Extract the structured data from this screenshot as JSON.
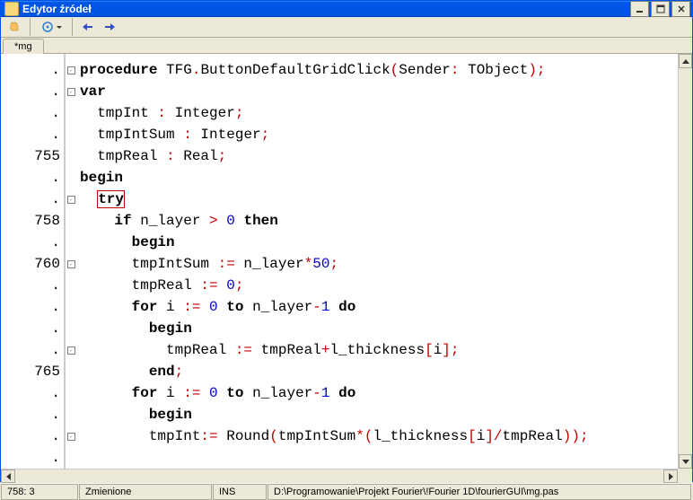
{
  "window": {
    "title": "Edytor źródeł"
  },
  "tab": {
    "label": "*mg"
  },
  "gutter": [
    ".",
    ".",
    ".",
    ".",
    "755",
    ".",
    ".",
    "758",
    ".",
    "760",
    ".",
    ".",
    ".",
    ".",
    "765",
    ".",
    ".",
    ".",
    "."
  ],
  "fold": [
    "-",
    "-",
    "",
    "",
    "",
    "",
    "-",
    "",
    "",
    "-",
    "",
    "",
    "",
    "-",
    "",
    "",
    "",
    "-",
    ""
  ],
  "code": [
    [
      [
        "kw",
        "procedure"
      ],
      [
        "txt",
        " TFG"
      ],
      [
        "sym",
        "."
      ],
      [
        "txt",
        "ButtonDefaultGridClick"
      ],
      [
        "sym",
        "("
      ],
      [
        "txt",
        "Sender"
      ],
      [
        "sym",
        ":"
      ],
      [
        "txt",
        " TObject"
      ],
      [
        "sym",
        ");"
      ]
    ],
    [
      [
        "kw",
        "var"
      ]
    ],
    [
      [
        "txt",
        "  tmpInt "
      ],
      [
        "sym",
        ":"
      ],
      [
        "txt",
        " Integer"
      ],
      [
        "sym",
        ";"
      ]
    ],
    [
      [
        "txt",
        "  tmpIntSum "
      ],
      [
        "sym",
        ":"
      ],
      [
        "txt",
        " Integer"
      ],
      [
        "sym",
        ";"
      ]
    ],
    [
      [
        "txt",
        "  tmpReal "
      ],
      [
        "sym",
        ":"
      ],
      [
        "txt",
        " Real"
      ],
      [
        "sym",
        ";"
      ]
    ],
    [
      [
        "kw",
        "begin"
      ]
    ],
    [
      [
        "txt",
        "  "
      ],
      [
        "tryhl",
        "try"
      ]
    ],
    [
      [
        "txt",
        "    "
      ],
      [
        "kw",
        "if"
      ],
      [
        "txt",
        " n_layer "
      ],
      [
        "sym",
        ">"
      ],
      [
        "txt",
        " "
      ],
      [
        "num",
        "0"
      ],
      [
        "txt",
        " "
      ],
      [
        "kw",
        "then"
      ]
    ],
    [
      [
        "txt",
        "      "
      ],
      [
        "kw",
        "begin"
      ]
    ],
    [
      [
        "txt",
        "      tmpIntSum "
      ],
      [
        "sym",
        ":="
      ],
      [
        "txt",
        " n_layer"
      ],
      [
        "sym",
        "*"
      ],
      [
        "num",
        "50"
      ],
      [
        "sym",
        ";"
      ]
    ],
    [
      [
        "txt",
        "      tmpReal "
      ],
      [
        "sym",
        ":="
      ],
      [
        "txt",
        " "
      ],
      [
        "num",
        "0"
      ],
      [
        "sym",
        ";"
      ]
    ],
    [
      [
        "txt",
        "      "
      ],
      [
        "kw",
        "for"
      ],
      [
        "txt",
        " i "
      ],
      [
        "sym",
        ":="
      ],
      [
        "txt",
        " "
      ],
      [
        "num",
        "0"
      ],
      [
        "txt",
        " "
      ],
      [
        "kw",
        "to"
      ],
      [
        "txt",
        " n_layer"
      ],
      [
        "sym",
        "-"
      ],
      [
        "num",
        "1"
      ],
      [
        "txt",
        " "
      ],
      [
        "kw",
        "do"
      ]
    ],
    [
      [
        "txt",
        "        "
      ],
      [
        "kw",
        "begin"
      ]
    ],
    [
      [
        "txt",
        "          tmpReal "
      ],
      [
        "sym",
        ":="
      ],
      [
        "txt",
        " tmpReal"
      ],
      [
        "sym",
        "+"
      ],
      [
        "txt",
        "l_thickness"
      ],
      [
        "sym",
        "["
      ],
      [
        "txt",
        "i"
      ],
      [
        "sym",
        "];"
      ]
    ],
    [
      [
        "txt",
        "        "
      ],
      [
        "kw",
        "end"
      ],
      [
        "sym",
        ";"
      ]
    ],
    [
      [
        "txt",
        "      "
      ],
      [
        "kw",
        "for"
      ],
      [
        "txt",
        " i "
      ],
      [
        "sym",
        ":="
      ],
      [
        "txt",
        " "
      ],
      [
        "num",
        "0"
      ],
      [
        "txt",
        " "
      ],
      [
        "kw",
        "to"
      ],
      [
        "txt",
        " n_layer"
      ],
      [
        "sym",
        "-"
      ],
      [
        "num",
        "1"
      ],
      [
        "txt",
        " "
      ],
      [
        "kw",
        "do"
      ]
    ],
    [
      [
        "txt",
        "        "
      ],
      [
        "kw",
        "begin"
      ]
    ],
    [
      [
        "txt",
        "        tmpInt"
      ],
      [
        "sym",
        ":="
      ],
      [
        "txt",
        " Round"
      ],
      [
        "sym",
        "("
      ],
      [
        "txt",
        "tmpIntSum"
      ],
      [
        "sym",
        "*("
      ],
      [
        "txt",
        "l_thickness"
      ],
      [
        "sym",
        "["
      ],
      [
        "txt",
        "i"
      ],
      [
        "sym",
        "]/"
      ],
      [
        "txt",
        "tmpReal"
      ],
      [
        "sym",
        "));"
      ]
    ]
  ],
  "status": {
    "pos": "758: 3",
    "state": "Zmienione",
    "mode": "INS",
    "path": "D:\\Programowanie\\Projekt Fourier\\!Fourier 1D\\fourierGUI\\mg.pas"
  }
}
